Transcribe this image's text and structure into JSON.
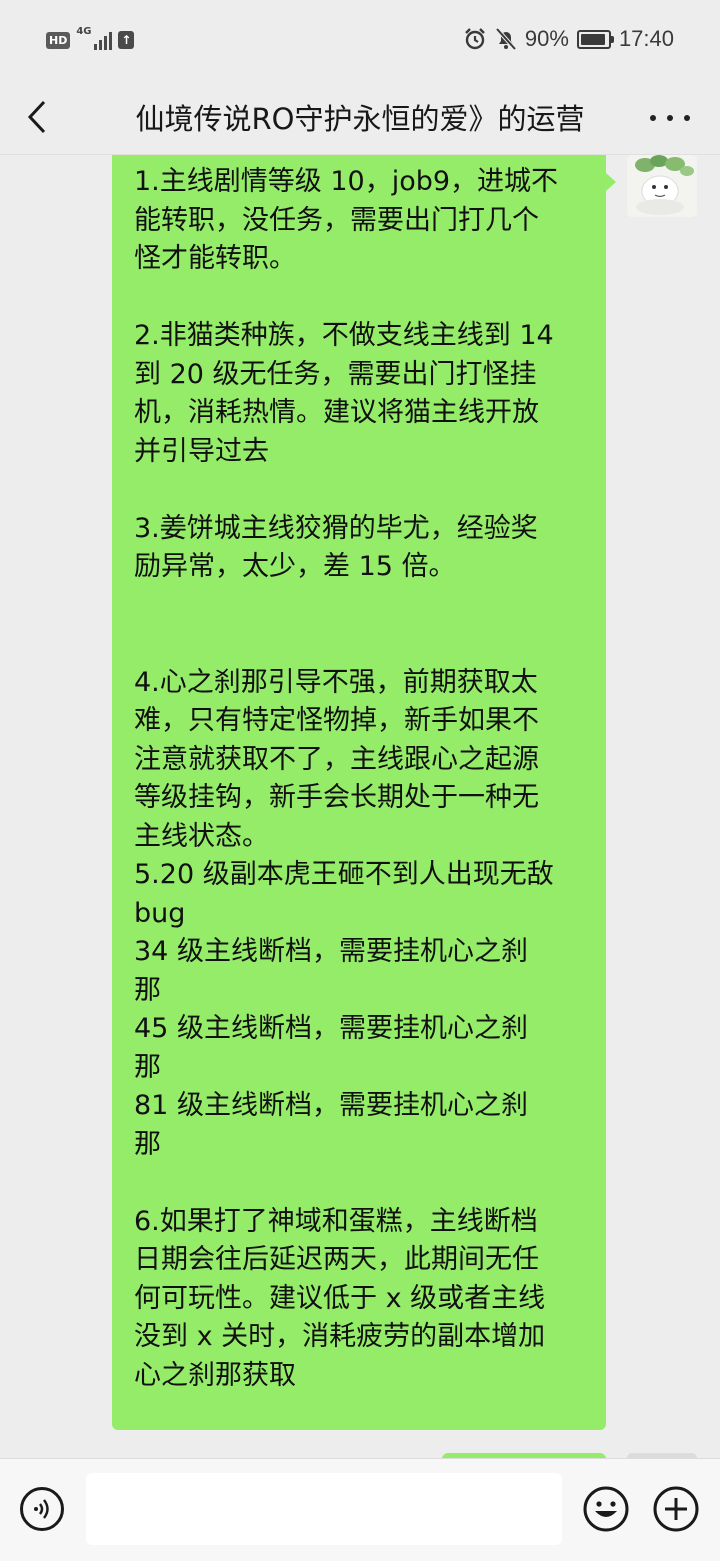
{
  "status_bar": {
    "network_badge": "HD",
    "network_type": "4G",
    "battery": "90%",
    "time": "17:40"
  },
  "header": {
    "title": "仙境传说RO守护永恒的爱》的运营"
  },
  "messages": [
    {
      "sender": "self",
      "lines": [
        "1.主线剧情等级 10，job9，进城不",
        "能转职，没任务，需要出门打几个",
        "怪才能转职。",
        "",
        "2.非猫类种族，不做支线主线到 14",
        "到 20 级无任务，需要出门打怪挂",
        "机，消耗热情。建议将猫主线开放",
        "并引导过去",
        "",
        "3.姜饼城主线狡猾的毕尤，经验奖",
        "励异常，太少，差 15 倍。",
        "",
        "",
        "4.心之刹那引导不强，前期获取太",
        "难，只有特定怪物掉，新手如果不",
        "注意就获取不了，主线跟心之起源",
        "等级挂钩，新手会长期处于一种无",
        "主线状态。",
        "5.20 级副本虎王砸不到人出现无敌",
        "bug",
        "34 级主线断档，需要挂机心之刹",
        "那",
        "45 级主线断档，需要挂机心之刹",
        "那",
        "81 级主线断档，需要挂机心之刹",
        "那",
        "",
        "6.如果打了神域和蛋糕，主线断档",
        "日期会往后延迟两天，此期间无任",
        "何可玩性。建议低于 x 级或者主线",
        "没到 x 关时，消耗疲劳的副本增加",
        "心之刹那获取"
      ]
    }
  ],
  "input": {
    "value": "",
    "placeholder": ""
  },
  "icons": {
    "back": "chevron-left-icon",
    "more": "more-dots-icon",
    "voice": "voice-icon",
    "emoji": "emoji-icon",
    "plus": "plus-icon"
  },
  "colors": {
    "background": "#ededed",
    "bubble_self": "#95ec69",
    "input_bar": "#f7f7f7"
  }
}
